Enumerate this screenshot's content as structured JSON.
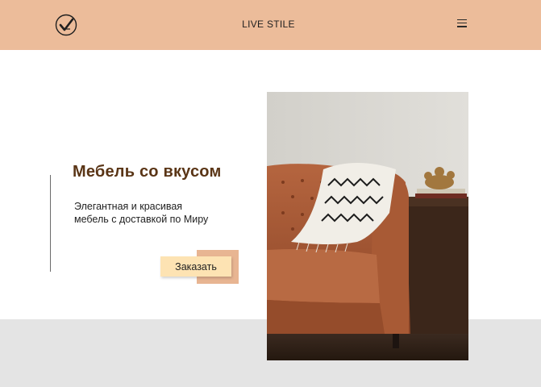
{
  "header": {
    "brand": "LIVE STILE",
    "logo_icon": "checkmark-circle-logo",
    "menu_icon": "hamburger-menu-icon"
  },
  "hero": {
    "title": "Мебель со вкусом",
    "description": "Элегантная и красивая мебель с доставкой по Миру",
    "cta_label": "Заказать",
    "image": "sofa-photo"
  },
  "colors": {
    "header_bg": "#ecbc9a",
    "title": "#5a3516",
    "button_bg": "#fde3b3",
    "button_shadow": "#e8b592",
    "band_bg": "#e4e4e4"
  }
}
